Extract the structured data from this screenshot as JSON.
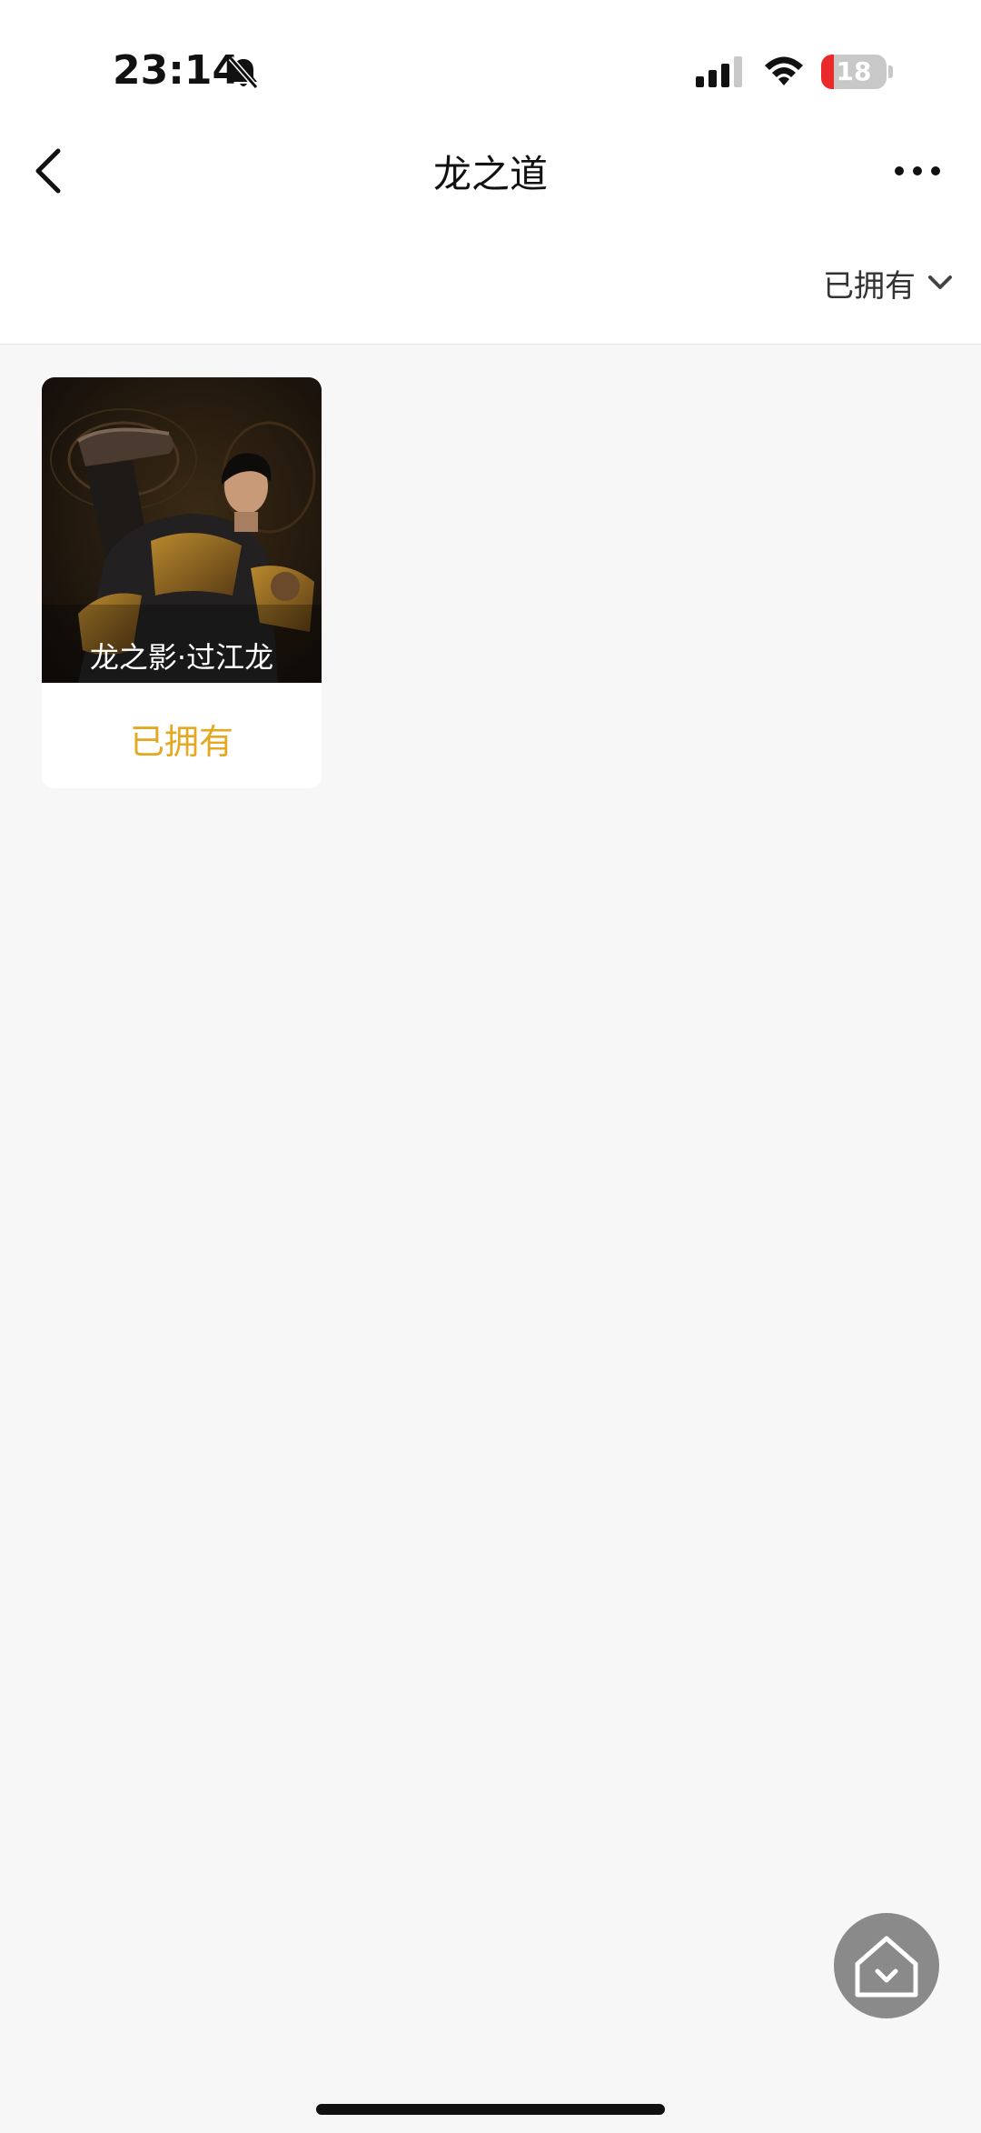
{
  "status_bar": {
    "time": "23:14",
    "battery_level": "18",
    "icons": [
      "bell-slash-icon",
      "signal-icon",
      "wifi-icon",
      "battery-icon"
    ]
  },
  "nav": {
    "title": "龙之道",
    "back_icon": "chevron-left-icon",
    "more_icon": "more-horizontal-icon"
  },
  "filter": {
    "label": "已拥有",
    "icon": "chevron-down-icon"
  },
  "items": [
    {
      "name": "龙之影·过江龙",
      "status": "已拥有"
    }
  ],
  "floating_button": {
    "icon": "home-icon"
  },
  "colors": {
    "accent": "#e4a821",
    "background": "#f7f7f7",
    "battery_low": "#ea2a2a"
  }
}
